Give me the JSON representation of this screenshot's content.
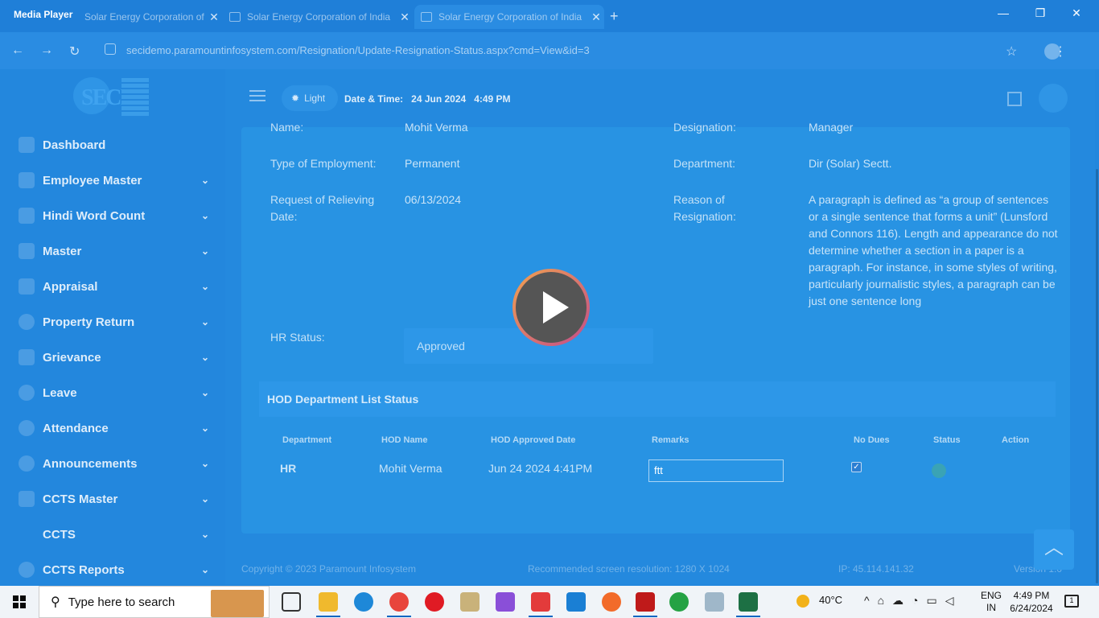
{
  "window": {
    "media_player_label": "Media Player",
    "tabs": [
      {
        "title": "Solar Energy Corporation of India"
      },
      {
        "title": "Solar Energy Corporation of India"
      },
      {
        "title": "Solar Energy Corporation of India"
      }
    ],
    "minimize": "—",
    "restore": "❐",
    "close": "✕",
    "new_tab": "+"
  },
  "address": {
    "url": "secidemo.paramountinfosystem.com/Resignation/Update-Resignation-Status.aspx?cmd=View&id=3"
  },
  "sidebar": {
    "items": [
      {
        "label": "Dashboard",
        "icon": "grid-icon"
      },
      {
        "label": "Employee Master",
        "icon": "user-icon"
      },
      {
        "label": "Hindi Word Count",
        "icon": "chat-icon"
      },
      {
        "label": "Master",
        "icon": "files-icon"
      },
      {
        "label": "Appraisal",
        "icon": "chart-icon"
      },
      {
        "label": "Property Return",
        "icon": "refresh-icon"
      },
      {
        "label": "Grievance",
        "icon": "briefcase-icon"
      },
      {
        "label": "Leave",
        "icon": "clock-icon"
      },
      {
        "label": "Attendance",
        "icon": "clock-icon"
      },
      {
        "label": "Announcements",
        "icon": "megaphone-icon"
      },
      {
        "label": "CCTS Master",
        "icon": "people-icon"
      },
      {
        "label": "CCTS",
        "icon": ""
      },
      {
        "label": "CCTS Reports",
        "icon": "report-icon"
      }
    ]
  },
  "topbar": {
    "theme_label": "Light",
    "datetime_label": "Date & Time:",
    "datetime_value": "24 Jun 2024   4:49 PM"
  },
  "form": {
    "name_label": "Name:",
    "name_value": "Mohit Verma",
    "designation_label": "Designation:",
    "designation_value": "Manager",
    "employment_label": "Type of Employment:",
    "employment_value": "Permanent",
    "department_label": "Department:",
    "department_value": "Dir (Solar) Sectt.",
    "relieving_label": "Request of Relieving Date:",
    "relieving_value": "06/13/2024",
    "reason_label": "Reason of Resignation:",
    "reason_value": "A paragraph is defined as “a group of sentences or a single sentence that forms a unit” (Lunsford and Connors 116). Length and appearance do not determine whether a section in a paper is a paragraph. For instance, in some styles of writing, particularly journalistic styles, a paragraph can be just one sentence long",
    "hr_status_label": "HR Status:",
    "hr_status_value": "Approved"
  },
  "hod": {
    "section_title": "HOD Department List Status",
    "columns": [
      "Department",
      "HOD Name",
      "HOD Approved Date",
      "Remarks",
      "No Dues",
      "Status",
      "Action"
    ],
    "row": {
      "department": "HR",
      "hod_name": "Mohit Verma",
      "approved_date": "Jun 24 2024 4:41PM",
      "remarks": "ftt",
      "no_dues_checked": true
    }
  },
  "footer": {
    "copyright": "Copyright © 2023 Paramount Infosystem",
    "resolution": "Recommended screen resolution: 1280 X 1024",
    "ip": "IP: 45.114.141.32",
    "version": "Version 1.0"
  },
  "taskbar": {
    "search_placeholder": "Type here to search",
    "temperature": "40°C",
    "lang_top": "ENG",
    "lang_bottom": "IN",
    "time": "4:49 PM",
    "date": "6/24/2024",
    "notif_count": "1",
    "colors": {
      "edge": "#1e88d8",
      "chrome": "#e8453c",
      "opera": "#e01b24",
      "vs": "#8a4fd8",
      "vscode": "#1a7fd4",
      "filezilla": "#bf1a1a",
      "whatsapp": "#25a244",
      "excel": "#1d7044"
    }
  }
}
